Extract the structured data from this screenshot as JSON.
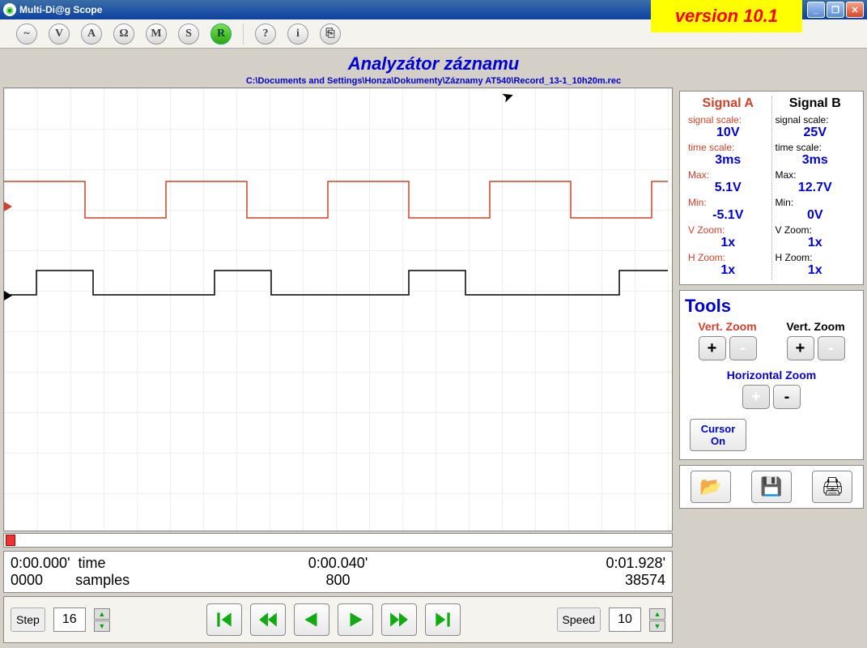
{
  "window": {
    "title": "Multi-Di@g Scope",
    "version_banner": "version 10.1"
  },
  "toolbar": [
    "~",
    "V",
    "A",
    "Ω",
    "M",
    "S",
    "R",
    "?",
    "i",
    "⎘"
  ],
  "header": {
    "title": "Analyzátor záznamu",
    "path": "C:\\Documents and Settings\\Honza\\Dokumenty\\Záznamy AT540\\Record_13-1_10h20m.rec"
  },
  "readout": {
    "time_label": "time",
    "samples_label": "samples",
    "t_start": "0:00.000'",
    "t_mid": "0:00.040'",
    "t_end": "0:01.928'",
    "s_start": "0000",
    "s_mid": "800",
    "s_end": "38574"
  },
  "playback": {
    "step_label": "Step",
    "step_value": "16",
    "speed_label": "Speed",
    "speed_value": "10"
  },
  "signals": {
    "A": {
      "name": "Signal A",
      "signal_scale_lbl": "signal scale:",
      "signal_scale": "10V",
      "time_scale_lbl": "time scale:",
      "time_scale": "3ms",
      "max_lbl": "Max:",
      "max": "5.1V",
      "min_lbl": "Min:",
      "min": "-5.1V",
      "vzoom_lbl": "V Zoom:",
      "vzoom": "1x",
      "hzoom_lbl": "H Zoom:",
      "hzoom": "1x"
    },
    "B": {
      "name": "Signal B",
      "signal_scale_lbl": "signal scale:",
      "signal_scale": "25V",
      "time_scale_lbl": "time scale:",
      "time_scale": "3ms",
      "max_lbl": "Max:",
      "max": "12.7V",
      "min_lbl": "Min:",
      "min": "0V",
      "vzoom_lbl": "V Zoom:",
      "vzoom": "1x",
      "hzoom_lbl": "H Zoom:",
      "hzoom": "1x"
    }
  },
  "tools": {
    "title": "Tools",
    "vz_a": "Vert. Zoom",
    "vz_b": "Vert. Zoom",
    "hz": "Horizontal Zoom",
    "plus": "+",
    "minus": "-",
    "cursor_btn_l1": "Cursor",
    "cursor_btn_l2": "On"
  },
  "chart_data": {
    "type": "line",
    "title": "Analyzátor záznamu",
    "xlabel": "time / samples",
    "x_range_time": [
      "0:00.000",
      "0:00.040"
    ],
    "total_time": "0:01.928",
    "x_range_samples": [
      0,
      800
    ],
    "total_samples": 38574,
    "series": [
      {
        "name": "Signal A",
        "color": "#d0402a",
        "y_scale_per_div": "10V",
        "x_scale_per_div": "3ms",
        "ylim": [
          -5.1,
          5.1
        ],
        "waveform_shape": "square",
        "levels": {
          "low": -5.1,
          "high": 5.1
        },
        "period_samples": 200,
        "duty_cycle": 0.5
      },
      {
        "name": "Signal B",
        "color": "#000000",
        "y_scale_per_div": "25V",
        "x_scale_per_div": "3ms",
        "ylim": [
          0,
          12.7
        ],
        "waveform_shape": "square",
        "levels": {
          "low": 0,
          "high": 12.7
        },
        "period_samples": 240,
        "duty_cycle": 0.28
      }
    ]
  }
}
